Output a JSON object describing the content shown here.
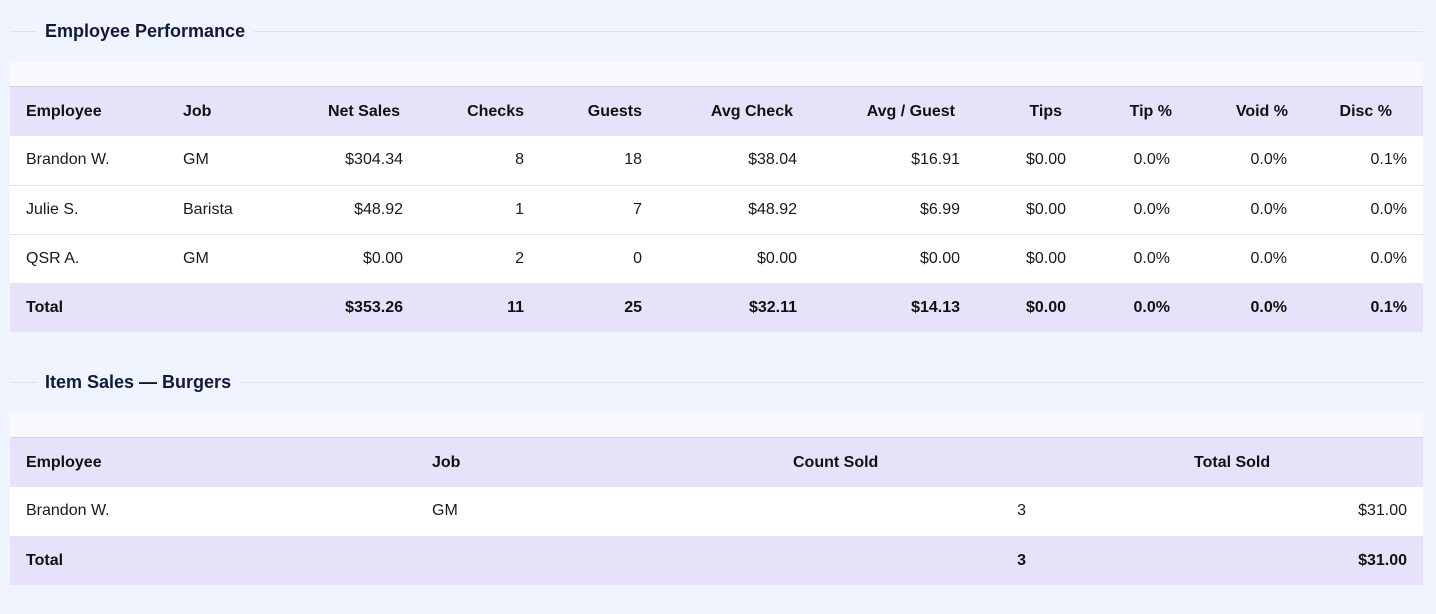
{
  "performance": {
    "title": "Employee Performance",
    "headers": [
      "Employee",
      "Job",
      "Net Sales",
      "Checks",
      "Guests",
      "Avg Check",
      "Avg / Guest",
      "Tips",
      "Tip %",
      "Void %",
      "Disc %"
    ],
    "rows": [
      [
        "Brandon W.",
        "GM",
        "$304.34",
        "8",
        "18",
        "$38.04",
        "$16.91",
        "$0.00",
        "0.0%",
        "0.0%",
        "0.1%"
      ],
      [
        "Julie S.",
        "Barista",
        "$48.92",
        "1",
        "7",
        "$48.92",
        "$6.99",
        "$0.00",
        "0.0%",
        "0.0%",
        "0.0%"
      ],
      [
        "QSR A.",
        "GM",
        "$0.00",
        "2",
        "0",
        "$0.00",
        "$0.00",
        "$0.00",
        "0.0%",
        "0.0%",
        "0.0%"
      ]
    ],
    "total": [
      "Total",
      "",
      "$353.26",
      "11",
      "25",
      "$32.11",
      "$14.13",
      "$0.00",
      "0.0%",
      "0.0%",
      "0.1%"
    ]
  },
  "items": {
    "title": "Item Sales — Burgers",
    "headers": [
      "Employee",
      "Job",
      "Count Sold",
      "Total Sold"
    ],
    "rows": [
      [
        "Brandon W.",
        "GM",
        "3",
        "$31.00"
      ]
    ],
    "total": [
      "Total",
      "",
      "3",
      "$31.00"
    ]
  }
}
